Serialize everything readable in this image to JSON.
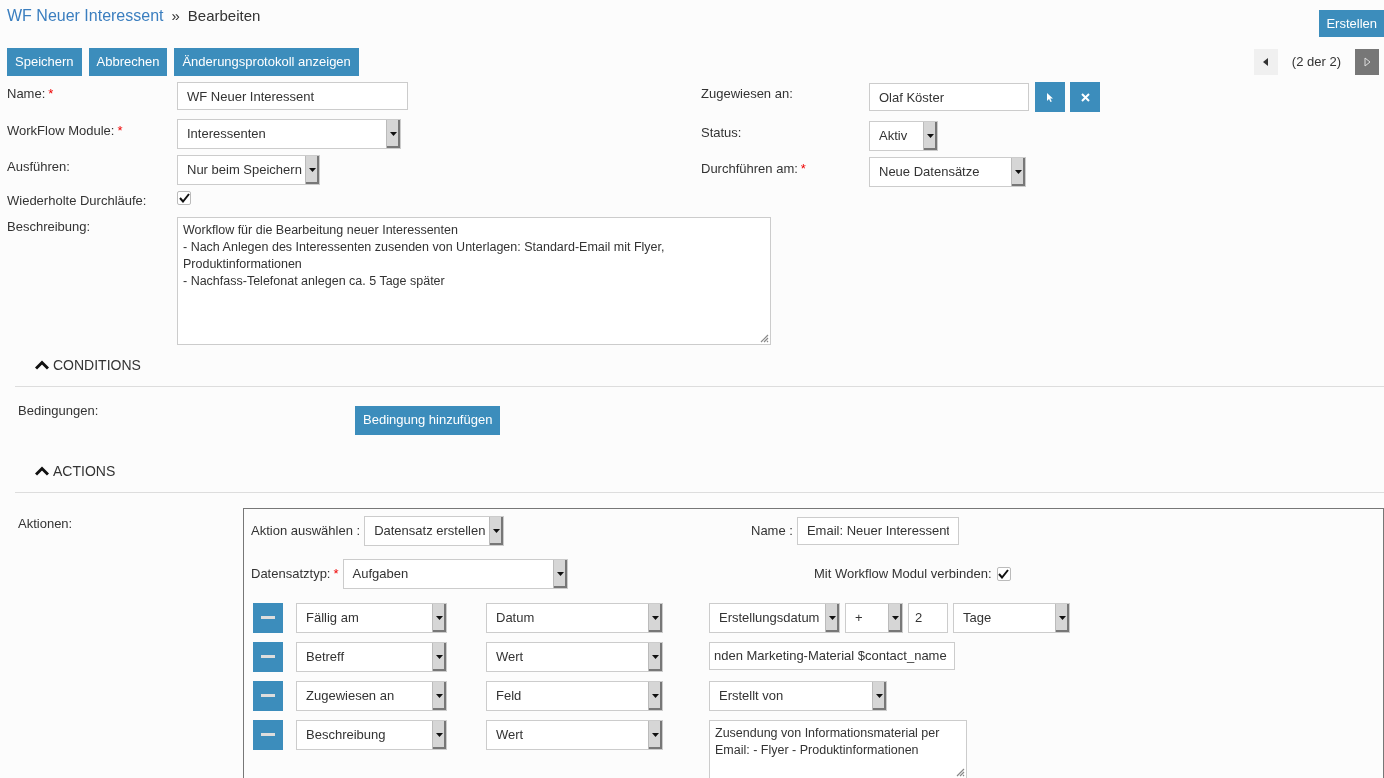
{
  "breadcrumb": {
    "module": "WF Neuer Interessent",
    "separator": "»",
    "current": "Bearbeiten"
  },
  "create_button": "Erstellen",
  "toolbar": [
    "Speichern",
    "Abbrechen",
    "Änderungsprotokoll anzeigen"
  ],
  "pager": {
    "text": "(2 der 2)",
    "prev_disabled": false,
    "next_disabled": true
  },
  "fields_left": [
    {
      "kind": "text",
      "label": "Name:",
      "required_mark": "*",
      "value": "WF Neuer Interessent"
    },
    {
      "kind": "select",
      "label": "WorkFlow Module:",
      "required_mark": "*",
      "value": "Interessenten"
    },
    {
      "kind": "select",
      "label": "Ausführen:",
      "value": "Nur beim Speichern"
    }
  ],
  "fields_right": [
    {
      "kind": "relate",
      "label": "Zugewiesen an:",
      "value": "Olaf Köster"
    },
    {
      "kind": "select",
      "label": "Status:",
      "value": "Aktiv"
    },
    {
      "kind": "select",
      "label": "Durchführen am:",
      "required_mark": "*",
      "value": "Neue Datensätze"
    }
  ],
  "fields_full": [
    {
      "kind": "checkbox",
      "label": "Wiederholte Durchläufe:",
      "checked": true
    },
    {
      "kind": "textarea",
      "label": "Beschreibung:",
      "value": "Workflow für die Bearbeitung neuer Interessenten\n- Nach Anlegen des Interessenten zusenden von Unterlagen: Standard-Email mit Flyer, Produktinformationen\n- Nachfass-Telefonat anlegen ca. 5 Tage später"
    }
  ],
  "conditions": {
    "title": "CONDITIONS",
    "expanded": true,
    "label": "Bedingungen:",
    "button": "Bedingung hinzufügen"
  },
  "actions": {
    "title": "ACTIONS",
    "expanded": true,
    "label": "Aktionen:",
    "action_label": "Aktion auswählen :",
    "action_value": "Datensatz erstellen",
    "name_label": "Name :",
    "name_value": "Email: Neuer Interessent",
    "type_label": "Datensatztyp:",
    "type_required_mark": "*",
    "type_value": "Aufgaben",
    "link_label": "Mit Workflow Modul verbinden:",
    "link_checked": true,
    "field_rows": [
      {
        "kind": "date",
        "field": "Fällig am",
        "mode": "Datum",
        "base": "Erstellungsdatum",
        "operator": "+",
        "amount": "2",
        "unit": "Tage"
      },
      {
        "kind": "text",
        "field": "Betreff",
        "mode": "Wert",
        "value": "nden Marketing-Material $contact_name"
      },
      {
        "kind": "select",
        "field": "Zugewiesen an",
        "mode": "Feld",
        "value": "Erstellt von"
      },
      {
        "kind": "textarea",
        "field": "Beschreibung",
        "mode": "Wert",
        "value": "Zusendung von Informationsmaterial per Email: - Flyer - Produktinformationen"
      }
    ]
  }
}
